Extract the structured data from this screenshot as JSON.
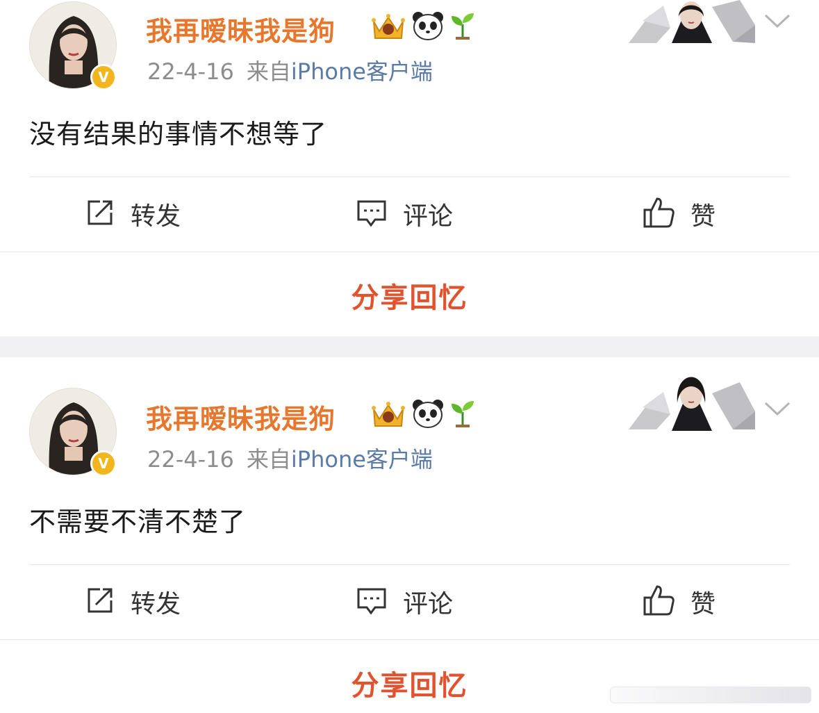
{
  "posts": [
    {
      "username": "我再暧昧我是狗",
      "date": "22-4-16",
      "source_prefix": "来自",
      "source_link": "iPhone客户端",
      "text": "没有结果的事情不想等了",
      "actions": {
        "repost": "转发",
        "comment": "评论",
        "like": "赞"
      },
      "share_label": "分享回忆",
      "verified_badge": "V"
    },
    {
      "username": "我再暧昧我是狗",
      "date": "22-4-16",
      "source_prefix": "来自",
      "source_link": "iPhone客户端",
      "text": "不需要不清不楚了",
      "actions": {
        "repost": "转发",
        "comment": "评论",
        "like": "赞"
      },
      "share_label": "分享回忆",
      "verified_badge": "V"
    }
  ],
  "icons": {
    "crown_badge": "crown-badge-icon",
    "panda_badge": "panda-icon",
    "sprout_badge": "sprout-icon",
    "repost": "repost-icon",
    "comment": "comment-icon",
    "like": "thumbs-up-icon",
    "more": "chevron-down-icon"
  },
  "colors": {
    "username": "#e8772e",
    "link": "#5a7aa8",
    "share": "#e0532e",
    "verified": "#f2b51b",
    "separator": "#f0f0f2"
  }
}
